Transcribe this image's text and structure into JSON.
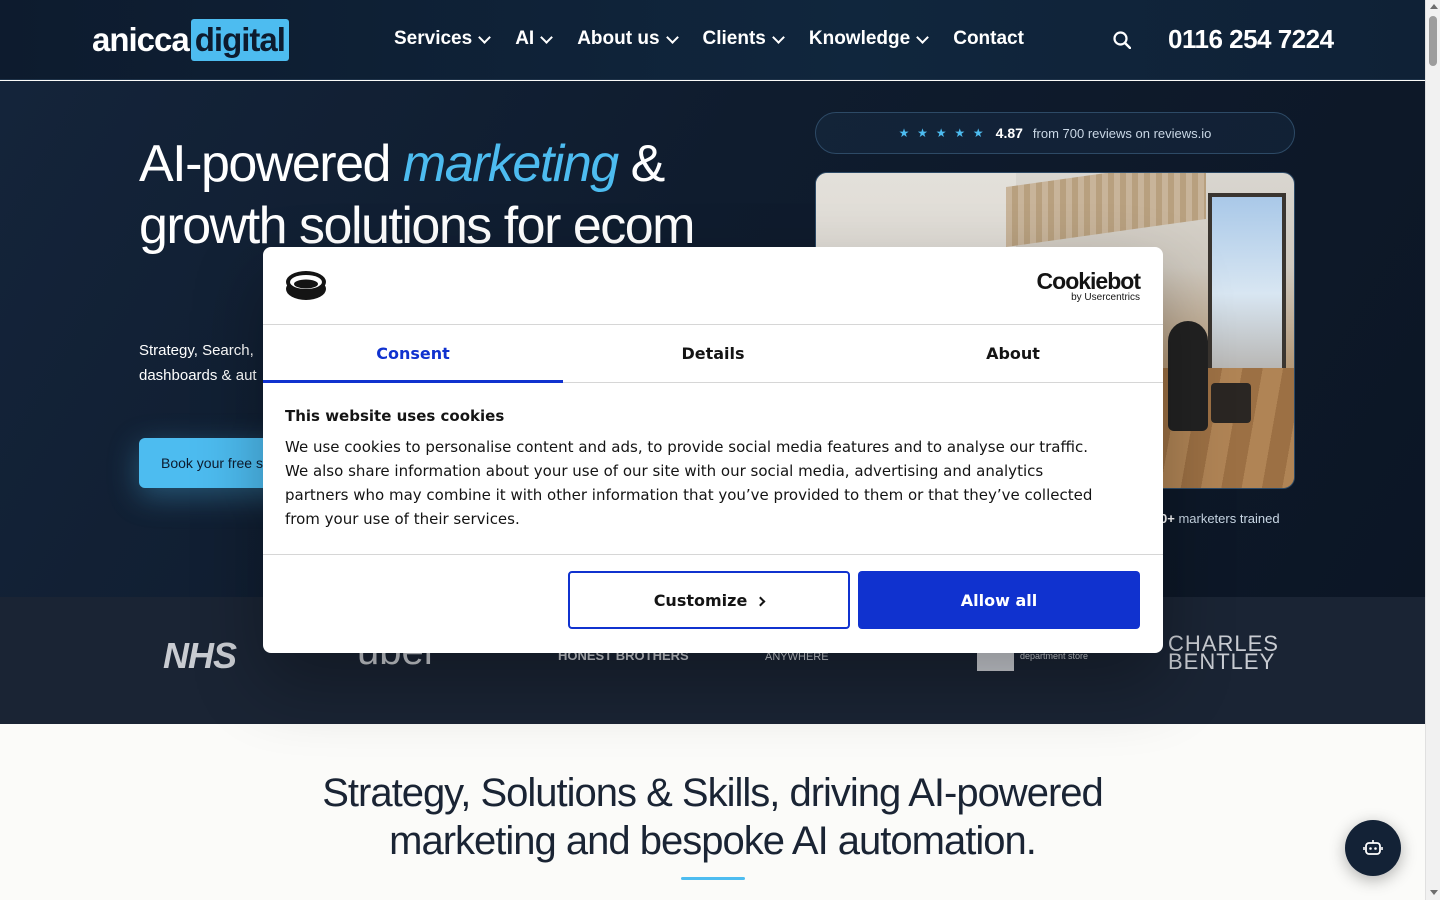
{
  "header": {
    "logo_part1": "anicca",
    "logo_part2": "digital",
    "nav": [
      {
        "label": "Services",
        "has_dropdown": true
      },
      {
        "label": "AI",
        "has_dropdown": true
      },
      {
        "label": "About us",
        "has_dropdown": true
      },
      {
        "label": "Clients",
        "has_dropdown": true
      },
      {
        "label": "Knowledge",
        "has_dropdown": true
      },
      {
        "label": "Contact",
        "has_dropdown": false
      }
    ],
    "search_icon": "search-icon",
    "phone": "0116 254 7224"
  },
  "hero": {
    "title_part1": "AI-powered ",
    "title_highlight": "marketing",
    "title_part2": " & growth solutions for ecom",
    "subtitle_line1": "Strategy, Search,",
    "subtitle_line2": "dashboards & aut",
    "cta_label": "Book your free s",
    "reviews": {
      "stars": "★ ★ ★ ★ ★",
      "rating": "4.87",
      "text": "from 700 reviews on reviews.io"
    },
    "trained_bold": "0+",
    "trained_text": " marketers trained"
  },
  "logos": {
    "nhs": "NHS",
    "uber": "uber",
    "honest_brothers": "HONEST BROTHERS",
    "anywhere": "ANYWHERE",
    "house_text": "department store",
    "charles_bentley_1": "CHARLES",
    "charles_bentley_2": "BENTLEY"
  },
  "section": {
    "heading_line1": "Strategy, Solutions & Skills, driving AI-powered",
    "heading_line2": "marketing and bespoke AI automation."
  },
  "cookie_dialog": {
    "brand_big": "Cookiebot",
    "brand_small": "by Usercentrics",
    "tabs": [
      {
        "label": "Consent",
        "active": true
      },
      {
        "label": "Details",
        "active": false
      },
      {
        "label": "About",
        "active": false
      }
    ],
    "title": "This website uses cookies",
    "body": "We use cookies to personalise content and ads, to provide social media features and to analyse our traffic. We also share information about your use of our site with our social media, advertising and analytics partners who may combine it with other information that you’ve provided to them or that they’ve collected from your use of their services.",
    "customize_label": "Customize",
    "allow_label": "Allow all"
  },
  "colors": {
    "accent": "#4dbcf0",
    "navy": "#0d1b2e",
    "cookie_blue": "#1032cf"
  }
}
